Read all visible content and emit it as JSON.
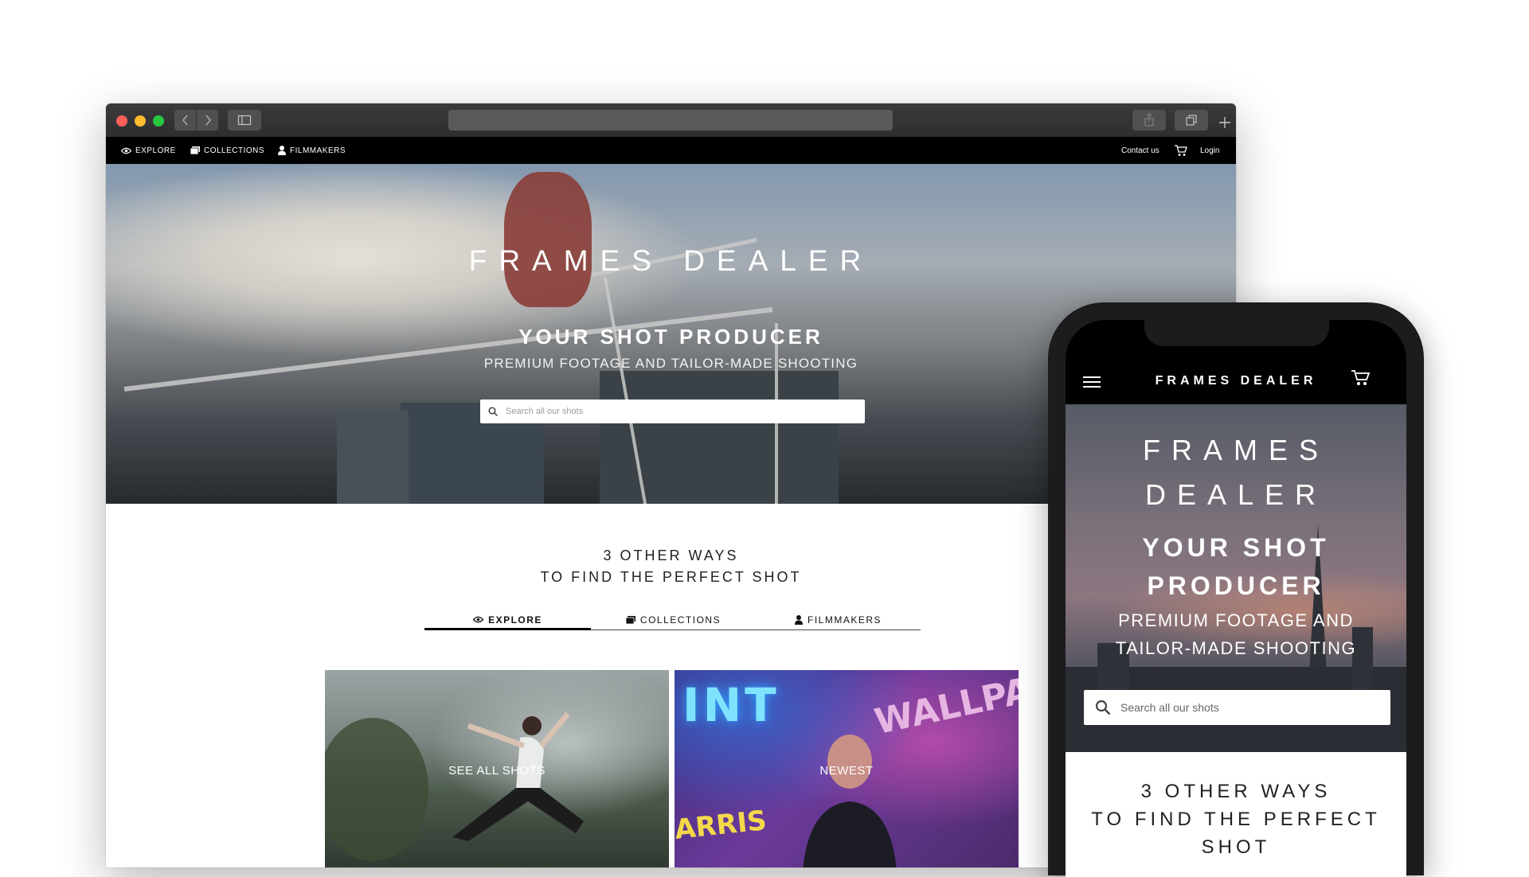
{
  "desktop": {
    "nav": {
      "explore": "EXPLORE",
      "collections": "COLLECTIONS",
      "filmmakers": "FILMMAKERS",
      "contact": "Contact us",
      "login": "Login"
    },
    "hero": {
      "title": "FRAMES DEALER",
      "subtitle": "YOUR SHOT PRODUCER",
      "tagline": "PREMIUM FOOTAGE AND TAILOR-MADE SHOOTING",
      "search_placeholder": "Search all our shots"
    },
    "ways": {
      "line1": "3 OTHER WAYS",
      "line2": "TO FIND THE PERFECT SHOT"
    },
    "tabs": [
      {
        "label": "EXPLORE",
        "active": true
      },
      {
        "label": "COLLECTIONS",
        "active": false
      },
      {
        "label": "FILMMAKERS",
        "active": false
      }
    ],
    "cards": [
      {
        "label": "SEE ALL SHOTS"
      },
      {
        "label": "NEWEST"
      }
    ]
  },
  "mobile": {
    "brand": "FRAMES DEALER",
    "hero": {
      "title_line1": "FRAMES",
      "title_line2": "DEALER",
      "subtitle_line1": "YOUR SHOT",
      "subtitle_line2": "PRODUCER",
      "tagline_line1": "PREMIUM FOOTAGE AND",
      "tagline_line2": "TAILOR-MADE SHOOTING",
      "search_placeholder": "Search all our shots"
    },
    "ways": {
      "line1": "3 OTHER WAYS",
      "line2": "TO FIND THE PERFECT",
      "line3": "SHOT"
    }
  },
  "colors": {
    "nav_bg": "#000000",
    "chrome_bg": "#2e2e30",
    "traffic_red": "#fe5f57",
    "traffic_yellow": "#febc2e",
    "traffic_green": "#28c840"
  }
}
